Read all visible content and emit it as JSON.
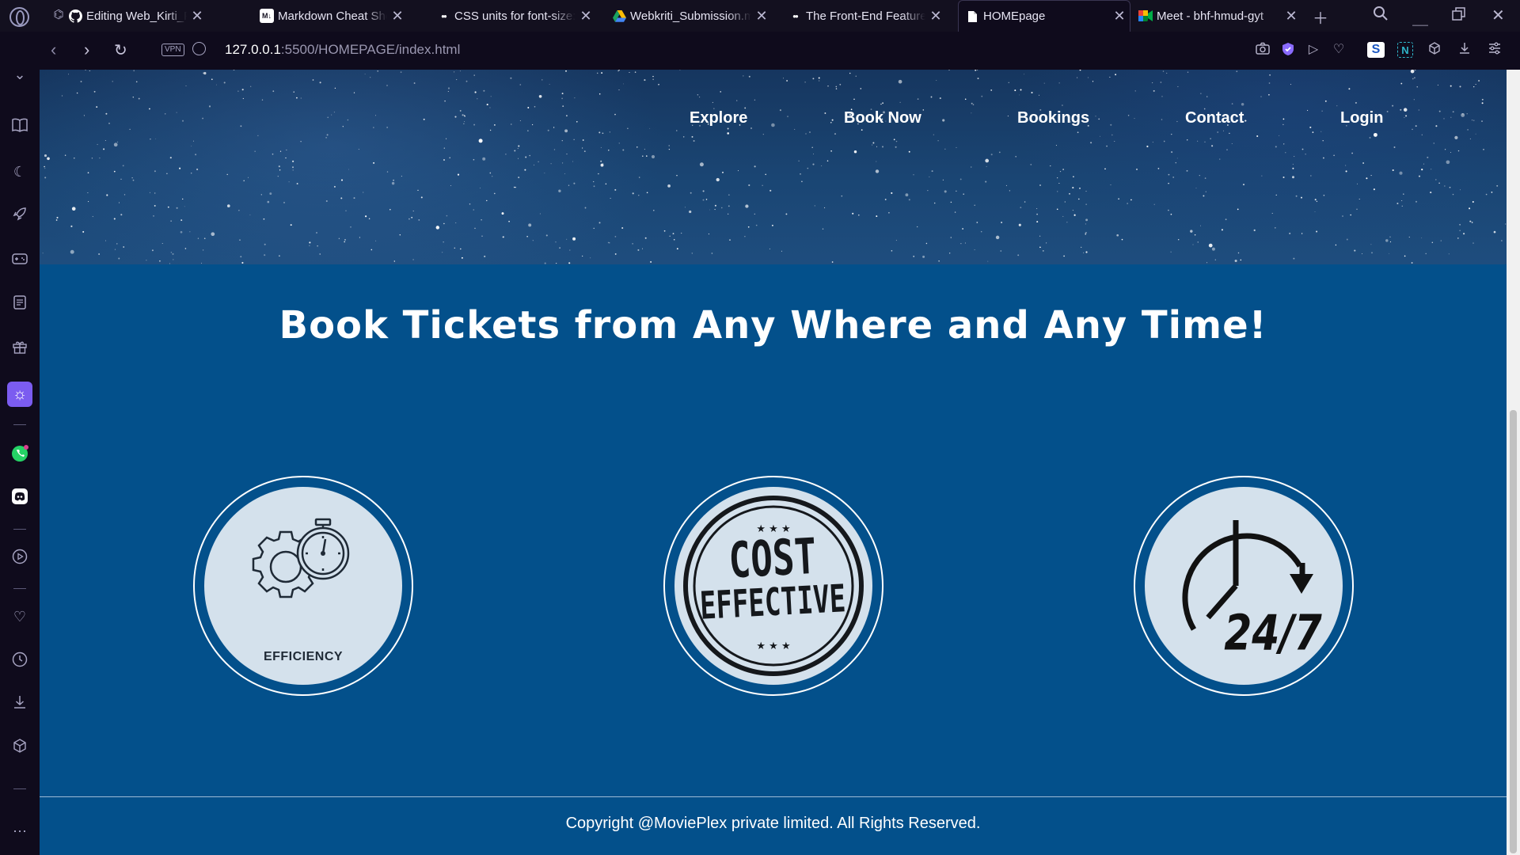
{
  "browser": {
    "tabs": [
      {
        "title": "Editing Web_Kirti_Proje",
        "icon": "github-icon"
      },
      {
        "title": "Markdown Cheat Sheet",
        "icon": "markdown-icon",
        "icon_text": "M↓"
      },
      {
        "title": "CSS units for font-size:",
        "icon": "medium-icon",
        "icon_text": "●●"
      },
      {
        "title": "Webkriti_Submission.m",
        "icon": "google-drive-icon"
      },
      {
        "title": "The Front-End Features",
        "icon": "medium-icon",
        "icon_text": "●●"
      },
      {
        "title": "HOMEpage",
        "icon": "document-icon",
        "active": true
      },
      {
        "title": "Meet - bhf-hmud-gyt",
        "icon": "google-meet-icon"
      }
    ],
    "address": {
      "vpn_label": "VPN",
      "host": "127.0.0.1",
      "path": ":5500/HOMEPAGE/index.html"
    }
  },
  "page": {
    "nav": [
      "Explore",
      "Book Now",
      "Bookings",
      "Contact",
      "Login"
    ],
    "headline": "Book Tickets from Any Where and Any Time!",
    "features": [
      {
        "icon": "efficiency-gear-stopwatch-icon",
        "caption": "EFFICIENCY"
      },
      {
        "icon": "cost-effective-stamp-icon",
        "stamp_lines": [
          "COST",
          "EFFECTIVE"
        ]
      },
      {
        "icon": "clock-24-7-icon",
        "badge": "24/7"
      }
    ],
    "footer": "Copyright @MoviePlex private limited. All Rights Reserved."
  },
  "colors": {
    "page_background": "#03508b",
    "hero_dark": "#16365f",
    "feature_circle": "#d4e1ec",
    "browser_chrome": "#0f0b1c"
  }
}
